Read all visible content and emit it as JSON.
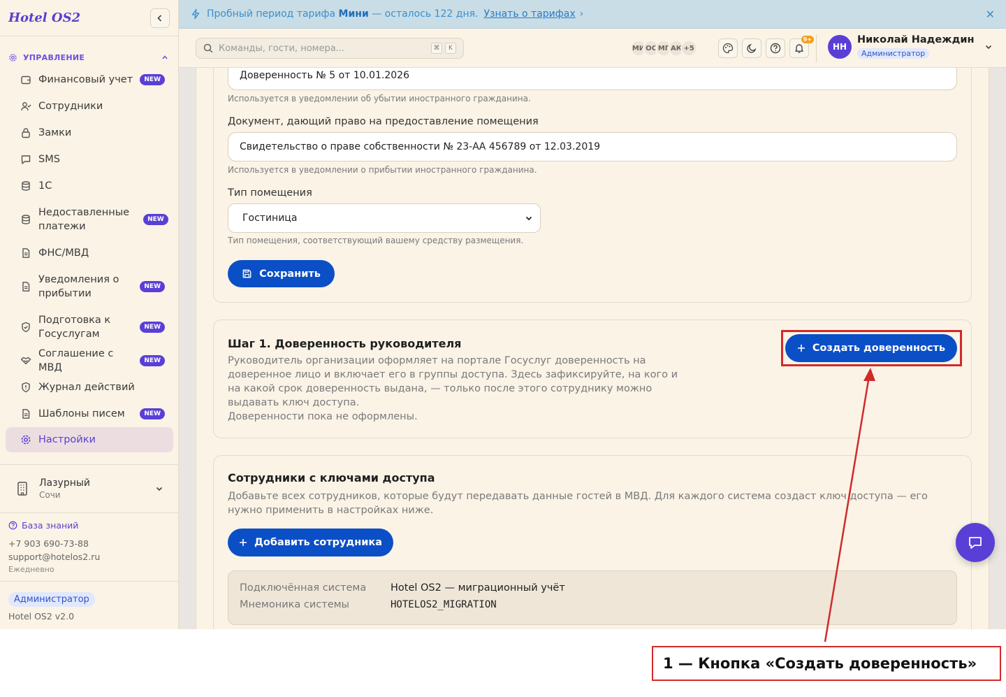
{
  "sidebar": {
    "logo": "Hotel OS2",
    "section_title": "УПРАВЛЕНИЕ",
    "items": [
      {
        "label": "Финансовый учет",
        "badge": "NEW"
      },
      {
        "label": "Сотрудники",
        "badge": ""
      },
      {
        "label": "Замки",
        "badge": ""
      },
      {
        "label": "SMS",
        "badge": ""
      },
      {
        "label": "1С",
        "badge": ""
      },
      {
        "label": "Недоставленные платежи",
        "badge": "NEW"
      },
      {
        "label": "ФНС/МВД",
        "badge": ""
      },
      {
        "label": "Уведомления о прибытии",
        "badge": "NEW"
      },
      {
        "label": "Подготовка к Госуслугам",
        "badge": "NEW"
      },
      {
        "label": "Соглашение с МВД",
        "badge": "NEW"
      },
      {
        "label": "Журнал действий",
        "badge": ""
      },
      {
        "label": "Шаблоны писем",
        "badge": "NEW"
      },
      {
        "label": "Настройки",
        "badge": ""
      }
    ],
    "hotel": {
      "name": "Лазурный",
      "city": "Сочи"
    },
    "knowledge_base": "База знаний",
    "phone": "+7 903 690-73-88",
    "email": "support@hotelos2.ru",
    "schedule": "Ежедневно",
    "role": "Администратор",
    "version": "Hotel OS2 v2.0"
  },
  "banner": {
    "text_before": "Пробный период тарифа ",
    "plan": "Мини",
    "text_after": " — осталось 122 дня.",
    "link": "Узнать о тарифах",
    "link_arrow": "›",
    "close": "✕"
  },
  "topbar": {
    "search_placeholder": "Команды, гости, номера...",
    "kbd_1": "⌘",
    "kbd_2": "K",
    "avatars": [
      "МИ",
      "ОС",
      "МГ",
      "АК",
      "+5"
    ],
    "notif_count": "9+",
    "user_initials": "НН",
    "user_name": "Николай Надеждин",
    "user_role": "Администратор"
  },
  "form": {
    "power_of_attorney_value": "Доверенность № 5 от 10.01.2026",
    "power_of_attorney_hint": "Используется в уведомлении об убытии иностранного гражданина.",
    "document_label": "Документ, дающий право на предоставление помещения",
    "document_value": "Свидетельство о праве собственности № 23-АА 456789 от 12.03.2019",
    "document_hint": "Используется в уведомлении о прибытии иностранного гражданина.",
    "premises_label": "Тип помещения",
    "premises_value": "Гостиница",
    "premises_hint": "Тип помещения, соответствующий вашему средству размещения.",
    "save_label": "Сохранить"
  },
  "step1": {
    "title": "Шаг 1. Доверенность руководителя",
    "description": "Руководитель организации оформляет на портале Госуслуг доверенность на доверенное лицо и включает его в группы доступа. Здесь зафиксируйте, на кого и на какой срок доверенность выдана, — только после этого сотруднику можно выдавать ключ доступа.",
    "empty": "Доверенности пока не оформлены.",
    "create_label": "Создать доверенность"
  },
  "employees": {
    "title": "Сотрудники с ключами доступа",
    "description": "Добавьте всех сотрудников, которые будут передавать данные гостей в МВД. Для каждого система создаст ключ доступа — его нужно применить в настройках ниже.",
    "add_label": "Добавить сотрудника",
    "system_key": "Подключённая система",
    "system_value": "Hotel OS2 — миграционный учёт",
    "mnemonic_key": "Мнемоника системы",
    "mnemonic_value": "HOTELOS2_MIGRATION"
  },
  "annotation": {
    "label": "1 — Кнопка «Создать доверенность»",
    "color": "#d12a2a"
  },
  "colors": {
    "accent": "#5b3fd0",
    "primary_button": "#0b4fc7",
    "card_bg": "#faf3e6"
  }
}
